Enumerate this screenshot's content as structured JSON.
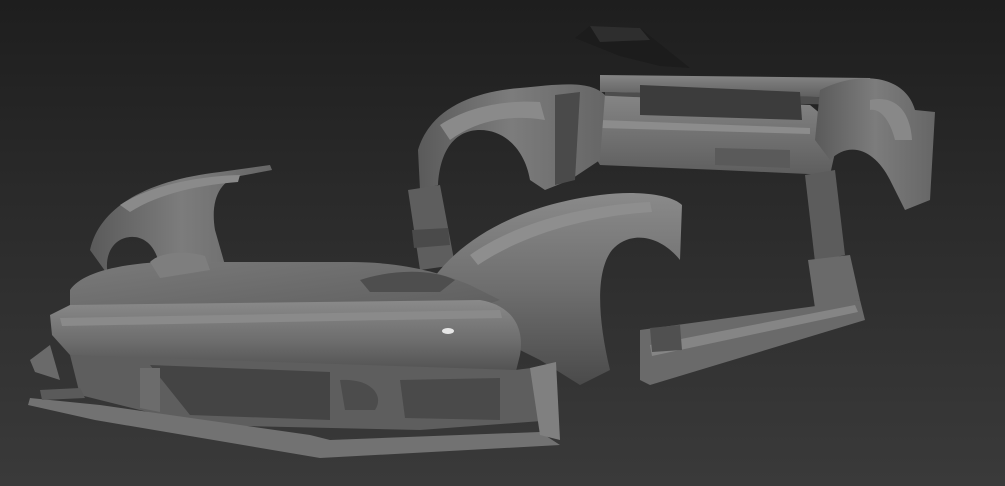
{
  "viewport": {
    "background_top": "#1e1e1e",
    "background_bottom": "#3a3a3a"
  },
  "model": {
    "body_color": "#6e6e6e",
    "shadow_color": "#3e3e3e",
    "highlight_color": "#9a9a9a",
    "dark_part_color": "#1f1f1f"
  }
}
